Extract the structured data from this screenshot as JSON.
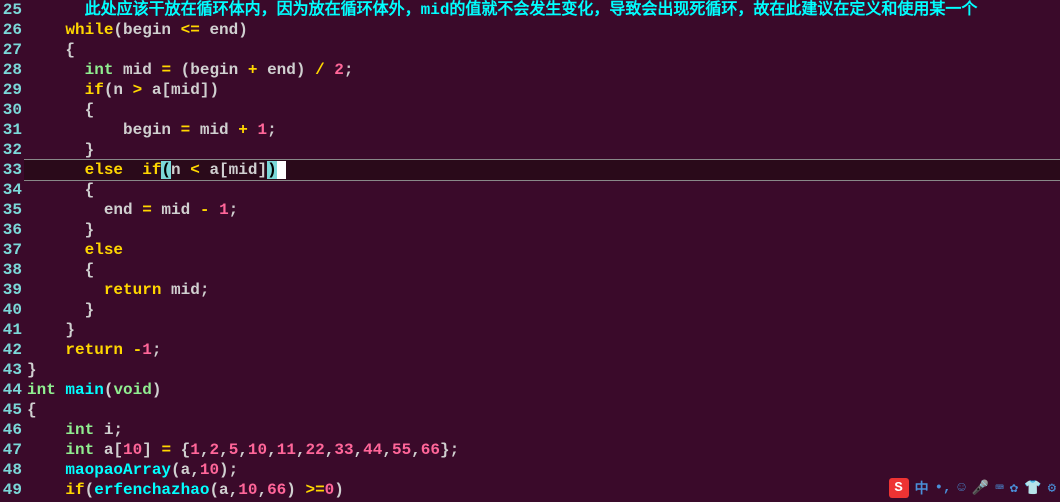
{
  "lines": [
    {
      "n": 25,
      "segs": [
        {
          "t": "      "
        },
        {
          "t": "此处应该干放在循环体内，因为放在循环体外，mid的值就不会发生变化，导致会出现死循环，故在此建议在定义和使用某一个",
          "c": "comment"
        }
      ]
    },
    {
      "n": 26,
      "segs": [
        {
          "t": "    "
        },
        {
          "t": "while",
          "c": "kw"
        },
        {
          "t": "(begin "
        },
        {
          "t": "<=",
          "c": "op"
        },
        {
          "t": " end)"
        }
      ]
    },
    {
      "n": 27,
      "segs": [
        {
          "t": "    {"
        }
      ]
    },
    {
      "n": 28,
      "segs": [
        {
          "t": "      "
        },
        {
          "t": "int",
          "c": "type"
        },
        {
          "t": " mid "
        },
        {
          "t": "=",
          "c": "op"
        },
        {
          "t": " (begin "
        },
        {
          "t": "+",
          "c": "op"
        },
        {
          "t": " end) "
        },
        {
          "t": "/",
          "c": "op"
        },
        {
          "t": " "
        },
        {
          "t": "2",
          "c": "num"
        },
        {
          "t": ";"
        }
      ]
    },
    {
      "n": 29,
      "segs": [
        {
          "t": "      "
        },
        {
          "t": "if",
          "c": "kw"
        },
        {
          "t": "(n "
        },
        {
          "t": ">",
          "c": "op"
        },
        {
          "t": " a[mid])"
        }
      ]
    },
    {
      "n": 30,
      "segs": [
        {
          "t": "      {"
        }
      ]
    },
    {
      "n": 31,
      "segs": [
        {
          "t": "          begin "
        },
        {
          "t": "=",
          "c": "op"
        },
        {
          "t": " mid "
        },
        {
          "t": "+",
          "c": "op"
        },
        {
          "t": " "
        },
        {
          "t": "1",
          "c": "num"
        },
        {
          "t": ";"
        }
      ]
    },
    {
      "n": 32,
      "segs": [
        {
          "t": "      }"
        }
      ]
    },
    {
      "n": 33,
      "segs": [
        {
          "t": "      "
        },
        {
          "t": "else",
          "c": "kw"
        },
        {
          "t": "  "
        },
        {
          "t": "if",
          "c": "kw"
        },
        {
          "t": "(",
          "c": "paren-match"
        },
        {
          "t": "n "
        },
        {
          "t": "<",
          "c": "op"
        },
        {
          "t": " a[mid]"
        },
        {
          "t": ")",
          "c": "paren-match"
        },
        {
          "t": " ",
          "c": "cursor"
        }
      ],
      "current": true
    },
    {
      "n": 34,
      "segs": [
        {
          "t": "      {"
        }
      ]
    },
    {
      "n": 35,
      "segs": [
        {
          "t": "        end "
        },
        {
          "t": "=",
          "c": "op"
        },
        {
          "t": " mid "
        },
        {
          "t": "-",
          "c": "op"
        },
        {
          "t": " "
        },
        {
          "t": "1",
          "c": "num"
        },
        {
          "t": ";"
        }
      ]
    },
    {
      "n": 36,
      "segs": [
        {
          "t": "      }"
        }
      ]
    },
    {
      "n": 37,
      "segs": [
        {
          "t": "      "
        },
        {
          "t": "else",
          "c": "kw"
        }
      ]
    },
    {
      "n": 38,
      "segs": [
        {
          "t": "      {"
        }
      ]
    },
    {
      "n": 39,
      "segs": [
        {
          "t": "        "
        },
        {
          "t": "return",
          "c": "kw"
        },
        {
          "t": " mid;"
        }
      ]
    },
    {
      "n": 40,
      "segs": [
        {
          "t": "      }"
        }
      ]
    },
    {
      "n": 41,
      "segs": [
        {
          "t": "    }"
        }
      ]
    },
    {
      "n": 42,
      "segs": [
        {
          "t": "    "
        },
        {
          "t": "return",
          "c": "kw"
        },
        {
          "t": " "
        },
        {
          "t": "-",
          "c": "op"
        },
        {
          "t": "1",
          "c": "num"
        },
        {
          "t": ";"
        }
      ]
    },
    {
      "n": 43,
      "segs": [
        {
          "t": "}"
        }
      ]
    },
    {
      "n": 44,
      "segs": [
        {
          "t": "int",
          "c": "type"
        },
        {
          "t": " "
        },
        {
          "t": "main",
          "c": "func"
        },
        {
          "t": "("
        },
        {
          "t": "void",
          "c": "type"
        },
        {
          "t": ")"
        }
      ]
    },
    {
      "n": 45,
      "segs": [
        {
          "t": "{"
        }
      ]
    },
    {
      "n": 46,
      "segs": [
        {
          "t": "    "
        },
        {
          "t": "int",
          "c": "type"
        },
        {
          "t": " i;"
        }
      ]
    },
    {
      "n": 47,
      "segs": [
        {
          "t": "    "
        },
        {
          "t": "int",
          "c": "type"
        },
        {
          "t": " a["
        },
        {
          "t": "10",
          "c": "num"
        },
        {
          "t": "] "
        },
        {
          "t": "=",
          "c": "op"
        },
        {
          "t": " {"
        },
        {
          "t": "1",
          "c": "num"
        },
        {
          "t": ","
        },
        {
          "t": "2",
          "c": "num"
        },
        {
          "t": ","
        },
        {
          "t": "5",
          "c": "num"
        },
        {
          "t": ","
        },
        {
          "t": "10",
          "c": "num"
        },
        {
          "t": ","
        },
        {
          "t": "11",
          "c": "num"
        },
        {
          "t": ","
        },
        {
          "t": "22",
          "c": "num"
        },
        {
          "t": ","
        },
        {
          "t": "33",
          "c": "num"
        },
        {
          "t": ","
        },
        {
          "t": "44",
          "c": "num"
        },
        {
          "t": ","
        },
        {
          "t": "55",
          "c": "num"
        },
        {
          "t": ","
        },
        {
          "t": "66",
          "c": "num"
        },
        {
          "t": "};"
        }
      ]
    },
    {
      "n": 48,
      "segs": [
        {
          "t": "    "
        },
        {
          "t": "maopaoArray",
          "c": "func"
        },
        {
          "t": "(a,"
        },
        {
          "t": "10",
          "c": "num"
        },
        {
          "t": ");"
        }
      ]
    },
    {
      "n": 49,
      "segs": [
        {
          "t": "    "
        },
        {
          "t": "if",
          "c": "kw"
        },
        {
          "t": "("
        },
        {
          "t": "erfenchazhao",
          "c": "func"
        },
        {
          "t": "(a,"
        },
        {
          "t": "10",
          "c": "num"
        },
        {
          "t": ","
        },
        {
          "t": "66",
          "c": "num"
        },
        {
          "t": ") "
        },
        {
          "t": ">=",
          "c": "op"
        },
        {
          "t": "0",
          "c": "num"
        },
        {
          "t": ")"
        }
      ]
    }
  ],
  "ime": {
    "s": "S",
    "cn": "中",
    "dot": "•,",
    "smile": "☺",
    "mic": "🎤",
    "kb": "⌨",
    "set": "✿",
    "shirt": "👕",
    "gear": "⚙"
  }
}
